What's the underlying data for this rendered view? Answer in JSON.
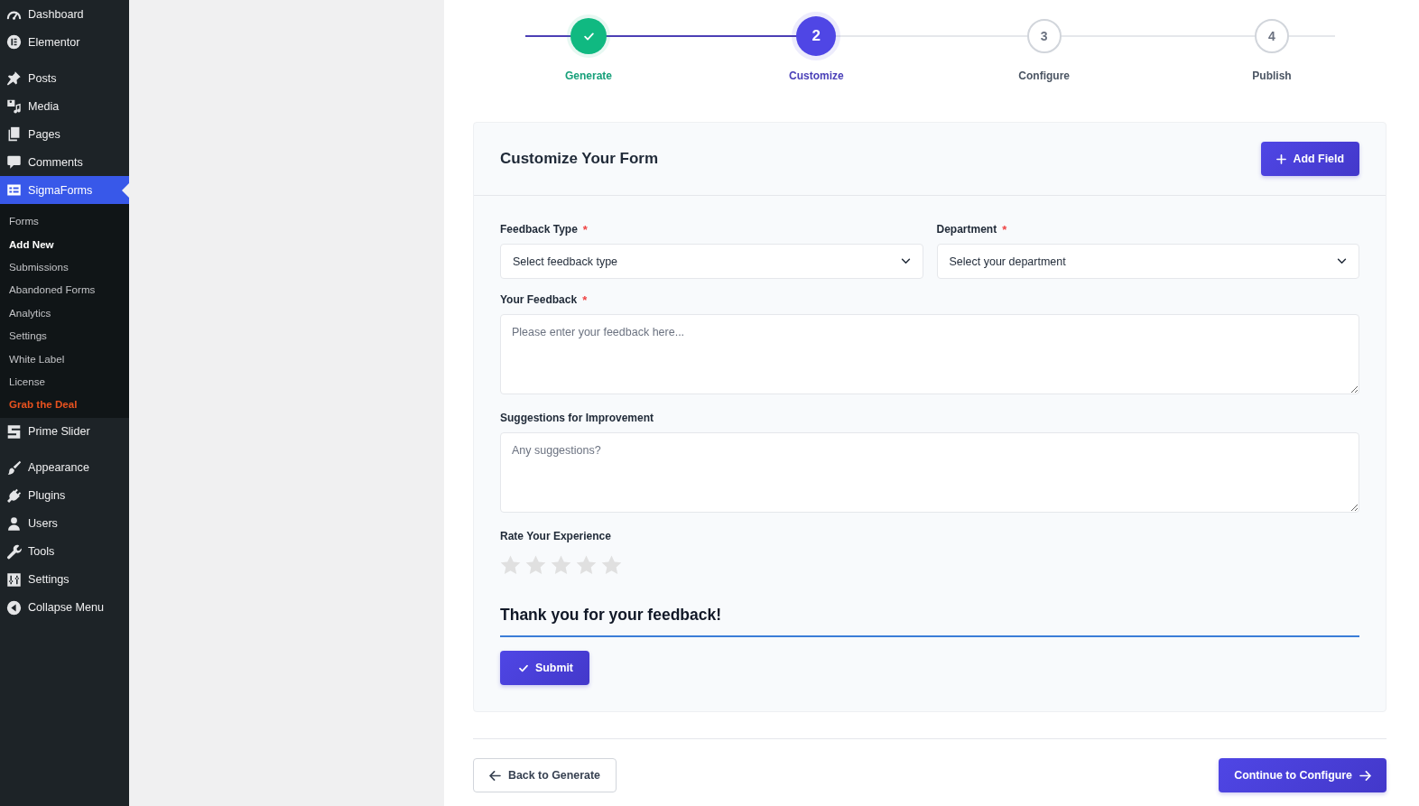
{
  "sidebar": {
    "groups": [
      {
        "items": [
          {
            "label": "Dashboard",
            "selected": false
          },
          {
            "label": "Elementor",
            "selected": false
          }
        ]
      },
      {
        "items": [
          {
            "label": "Posts",
            "selected": false
          },
          {
            "label": "Media",
            "selected": false
          },
          {
            "label": "Pages",
            "selected": false
          },
          {
            "label": "Comments",
            "selected": false
          },
          {
            "label": "SigmaForms",
            "selected": true,
            "children": [
              {
                "label": "Forms",
                "selected": false,
                "kind": "page"
              },
              {
                "label": "Add New",
                "selected": true,
                "kind": "page"
              },
              {
                "label": "Submissions",
                "selected": false,
                "kind": "page"
              },
              {
                "label": "Abandoned Forms",
                "selected": false,
                "kind": "page"
              },
              {
                "label": "Analytics",
                "selected": false,
                "kind": "page"
              },
              {
                "label": "Settings",
                "selected": false,
                "kind": "page"
              },
              {
                "label": "White Label",
                "selected": false,
                "kind": "page"
              },
              {
                "label": "License",
                "selected": false,
                "kind": "page"
              },
              {
                "label": "Grab the Deal",
                "selected": false,
                "kind": "promo"
              }
            ]
          },
          {
            "label": "Prime Slider",
            "selected": false
          }
        ]
      },
      {
        "items": [
          {
            "label": "Appearance",
            "selected": false
          },
          {
            "label": "Plugins",
            "selected": false
          },
          {
            "label": "Users",
            "selected": false
          },
          {
            "label": "Tools",
            "selected": false
          },
          {
            "label": "Settings",
            "selected": false
          },
          {
            "label": "Collapse Menu",
            "selected": false
          }
        ]
      }
    ]
  },
  "stepper": {
    "level": 0.36,
    "steps": [
      {
        "label": "Generate",
        "completed": true,
        "selected": false
      },
      {
        "label": "Customize",
        "number": "2",
        "completed": false,
        "selected": true
      },
      {
        "label": "Configure",
        "number": "3",
        "completed": false,
        "selected": false
      },
      {
        "label": "Publish",
        "number": "4",
        "completed": false,
        "selected": false
      }
    ]
  },
  "form": {
    "title": "Customize Your Form",
    "add_button": "Add Field",
    "fields": [
      {
        "kind": "select",
        "label": "Feedback Type",
        "required_mark": "*",
        "placeholder": "Select feedback type"
      },
      {
        "kind": "select",
        "label": "Department",
        "required_mark": "*",
        "placeholder": "Select your department"
      },
      {
        "kind": "textarea",
        "label": "Your Feedback",
        "required_mark": "*",
        "placeholder": "Please enter your feedback here..."
      },
      {
        "kind": "textarea",
        "label": "Suggestions for Improvement",
        "placeholder": "Any suggestions?"
      },
      {
        "kind": "rating",
        "label": "Rate Your Experience",
        "stars": 0
      },
      {
        "kind": "heading",
        "text": "Thank you for your feedback!"
      },
      {
        "kind": "submit",
        "label": "Submit"
      }
    ]
  },
  "navigation": [
    {
      "label": "Back to Generate",
      "kind": "back"
    },
    {
      "label": "Continue to Configure",
      "kind": "next"
    }
  ]
}
